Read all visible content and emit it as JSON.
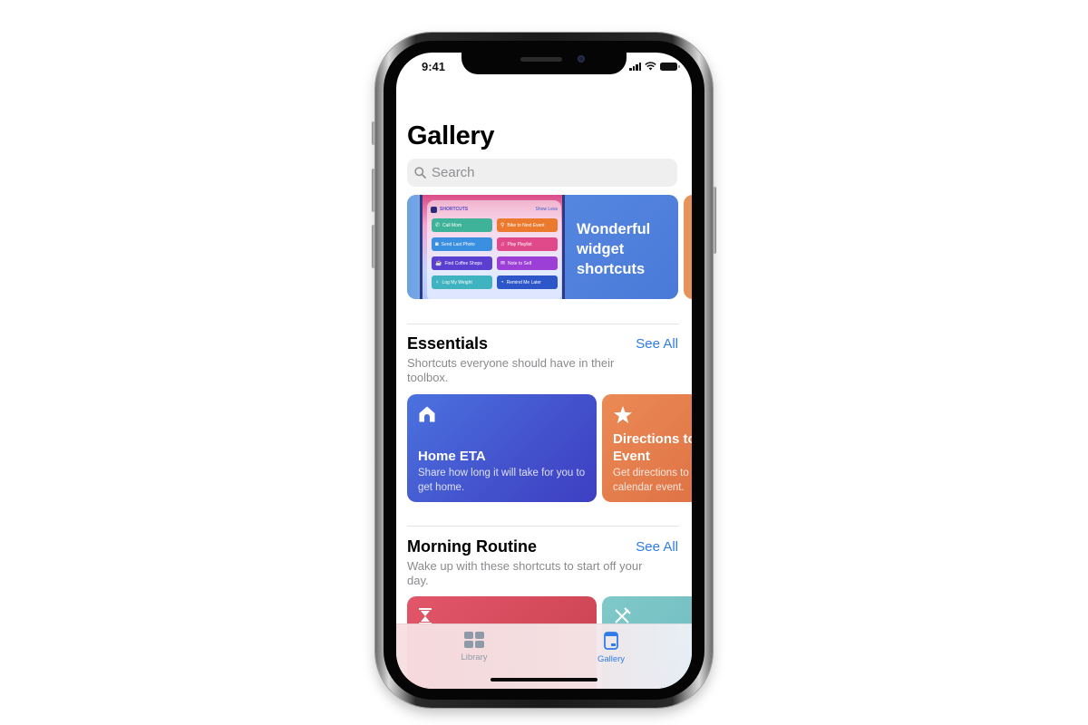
{
  "status_bar": {
    "time": "9:41",
    "icons": [
      "cellular-signal-icon",
      "wifi-icon",
      "battery-icon"
    ]
  },
  "page": {
    "title": "Gallery"
  },
  "search": {
    "placeholder": "Search",
    "value": "",
    "icon": "search-icon"
  },
  "featured": {
    "title": "Wonderful widget shortcuts",
    "widget": {
      "app_name": "SHORTCUTS",
      "toggle_label": "Show Less",
      "buttons": [
        {
          "label": "Call Mom",
          "icon": "phone-icon",
          "color": "#3fb39a"
        },
        {
          "label": "Bike to Next Event",
          "icon": "location-pin-icon",
          "color": "#ec7a2e"
        },
        {
          "label": "Send Last Photo",
          "icon": "camera-icon",
          "color": "#3b8fe0"
        },
        {
          "label": "Play Playlist",
          "icon": "music-note-icon",
          "color": "#e04a8a"
        },
        {
          "label": "Find Coffee Shops",
          "icon": "coffee-cup-icon",
          "color": "#5a3fd0"
        },
        {
          "label": "Note to Self",
          "icon": "envelope-icon",
          "color": "#9b3fd6"
        },
        {
          "label": "Log My Weight",
          "icon": "person-icon",
          "color": "#3fb3c0"
        },
        {
          "label": "Remind Me Later",
          "icon": "clock-icon",
          "color": "#2d56c8"
        }
      ]
    },
    "accent_colors": {
      "banner": "#4f82dc",
      "next_banner": "#e8935a"
    }
  },
  "sections": [
    {
      "title": "Essentials",
      "see_all": "See All",
      "subtitle": "Shortcuts everyone should have in their toolbox.",
      "cards": [
        {
          "title": "Home ETA",
          "description": "Share how long it will take for you to get home.",
          "icon": "house-icon",
          "colors": [
            "#4a6fde",
            "#3f43c6"
          ]
        },
        {
          "title": "Directions to Event",
          "description": "Get directions to calendar event.",
          "icon": "star-icon",
          "colors": [
            "#e8844e",
            "#d9663c"
          ]
        }
      ]
    },
    {
      "title": "Morning Routine",
      "see_all": "See All",
      "subtitle": "Wake up with these shortcuts to start off your day.",
      "cards": [
        {
          "title": "",
          "description": "",
          "icon": "hourglass-icon",
          "colors": [
            "#e05265",
            "#c9404f"
          ]
        },
        {
          "title": "",
          "description": "",
          "icon": "fork-knife-icon",
          "colors": [
            "#7cc6c8",
            "#66b4ba"
          ]
        }
      ]
    }
  ],
  "tab_bar": {
    "tabs": [
      {
        "label": "Library",
        "icon": "grid-icon",
        "selected": false,
        "color": "#8e9aa8"
      },
      {
        "label": "Gallery",
        "icon": "gallery-icon",
        "selected": true,
        "color": "#2f7be8"
      }
    ]
  }
}
